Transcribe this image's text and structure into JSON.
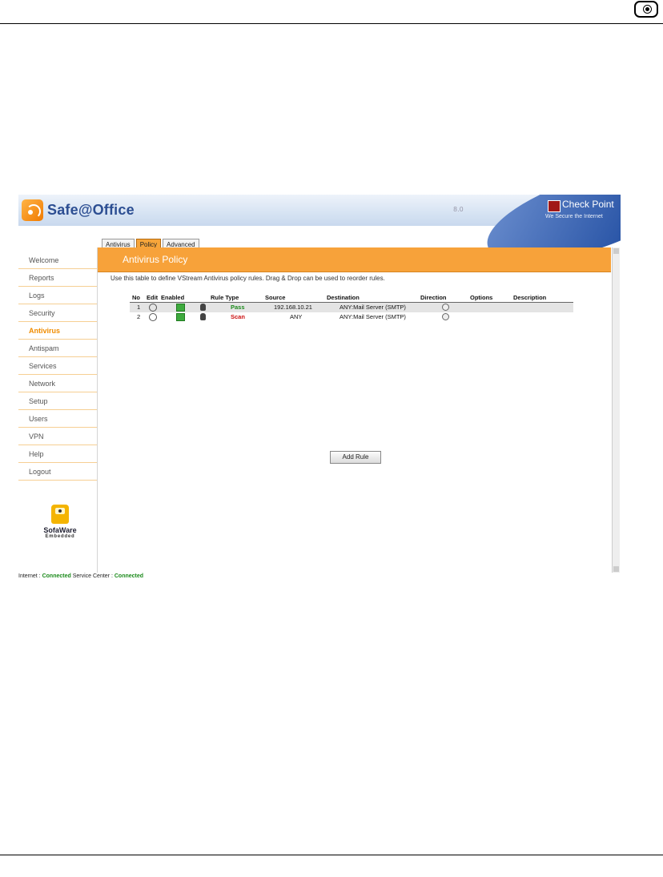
{
  "app": {
    "brand": "Safe@Office",
    "version": "8.0",
    "vendor": "Check Point",
    "vendor_tagline": "We Secure the Internet"
  },
  "tabs": [
    {
      "label": "Antivirus",
      "active": false
    },
    {
      "label": "Policy",
      "active": true
    },
    {
      "label": "Advanced",
      "active": false
    }
  ],
  "sidebar": {
    "items": [
      {
        "label": "Welcome"
      },
      {
        "label": "Reports"
      },
      {
        "label": "Logs"
      },
      {
        "label": "Security"
      },
      {
        "label": "Antivirus",
        "active": true
      },
      {
        "label": "Antispam"
      },
      {
        "label": "Services"
      },
      {
        "label": "Network"
      },
      {
        "label": "Setup"
      },
      {
        "label": "Users"
      },
      {
        "label": "VPN"
      },
      {
        "label": "Help"
      },
      {
        "label": "Logout"
      }
    ],
    "sofaware_brand": "SofaWare",
    "sofaware_sub": "Embedded"
  },
  "panel": {
    "title": "Antivirus Policy",
    "description": "Use this table to define VStream Antivirus policy rules. Drag & Drop can be used to reorder rules.",
    "add_rule_label": "Add Rule"
  },
  "table": {
    "headers": {
      "no": "No",
      "edit": "Edit",
      "enabled": "Enabled",
      "rule_type": "Rule Type",
      "source": "Source",
      "destination": "Destination",
      "direction": "Direction",
      "options": "Options",
      "description": "Description"
    },
    "rows": [
      {
        "no": "1",
        "rule_type": "Pass",
        "source": "192.168.10.21",
        "destination": "ANY:Mail Server (SMTP)"
      },
      {
        "no": "2",
        "rule_type": "Scan",
        "source": "ANY",
        "destination": "ANY:Mail Server (SMTP)"
      }
    ]
  },
  "status": {
    "internet_label": "Internet :",
    "internet_value": "Connected",
    "service_label": "Service Center :",
    "service_value": "Connected"
  },
  "colors": {
    "accent": "#f7a23a",
    "pass": "#1b8a1b",
    "scan": "#cc1111"
  }
}
